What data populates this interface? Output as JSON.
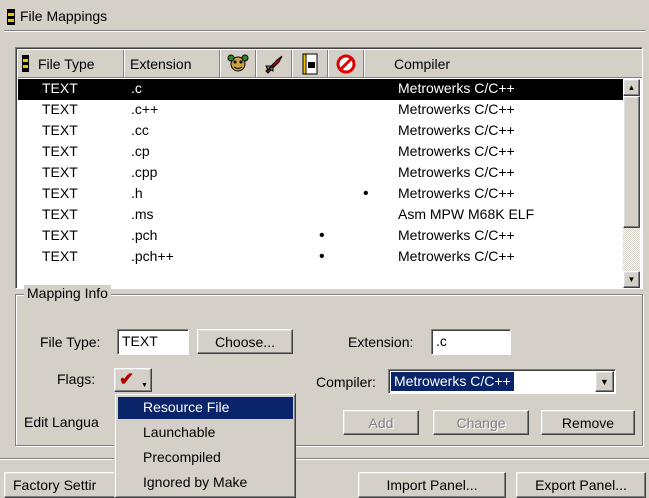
{
  "window": {
    "title": "File Mappings"
  },
  "table": {
    "columns": {
      "file_type": "File Type",
      "extension": "Extension",
      "compiler": "Compiler"
    },
    "header_icons": [
      "panel-icon",
      "resource-icon",
      "launch-icon",
      "precompiled-icon",
      "ignore-icon"
    ],
    "rows": [
      {
        "type": "TEXT",
        "ext": ".c",
        "flag_precompiled": "",
        "flag_ignored": "",
        "compiler": "Metrowerks C/C++"
      },
      {
        "type": "TEXT",
        "ext": ".c++",
        "flag_precompiled": "",
        "flag_ignored": "",
        "compiler": "Metrowerks C/C++"
      },
      {
        "type": "TEXT",
        "ext": ".cc",
        "flag_precompiled": "",
        "flag_ignored": "",
        "compiler": "Metrowerks C/C++"
      },
      {
        "type": "TEXT",
        "ext": ".cp",
        "flag_precompiled": "",
        "flag_ignored": "",
        "compiler": "Metrowerks C/C++"
      },
      {
        "type": "TEXT",
        "ext": ".cpp",
        "flag_precompiled": "",
        "flag_ignored": "",
        "compiler": "Metrowerks C/C++"
      },
      {
        "type": "TEXT",
        "ext": ".h",
        "flag_precompiled": "",
        "flag_ignored": "•",
        "compiler": "Metrowerks C/C++"
      },
      {
        "type": "TEXT",
        "ext": ".ms",
        "flag_precompiled": "",
        "flag_ignored": "",
        "compiler": "Asm MPW M68K ELF"
      },
      {
        "type": "TEXT",
        "ext": ".pch",
        "flag_precompiled": "•",
        "flag_ignored": "",
        "compiler": "Metrowerks C/C++"
      },
      {
        "type": "TEXT",
        "ext": ".pch++",
        "flag_precompiled": "•",
        "flag_ignored": "",
        "compiler": "Metrowerks C/C++"
      }
    ],
    "selected_row": 0
  },
  "mapping_info": {
    "legend": "Mapping Info",
    "file_type_label": "File Type:",
    "file_type_value": "TEXT",
    "choose_button": "Choose...",
    "extension_label": "Extension:",
    "extension_value": ".c",
    "flags_label": "Flags:",
    "compiler_label": "Compiler:",
    "compiler_value": "Metrowerks C/C++",
    "edit_language_label": "Edit Langua",
    "add_button": "Add",
    "change_button": "Change",
    "remove_button": "Remove"
  },
  "flags_menu": {
    "items": [
      "Resource File",
      "Launchable",
      "Precompiled",
      "Ignored by Make"
    ],
    "highlighted": 0
  },
  "footer": {
    "factory_settings_button": "Factory Settir",
    "import_button": "Import Panel...",
    "export_button": "Export Panel..."
  },
  "colors": {
    "selection": "#0a246a",
    "row_selected": "#000000",
    "panel_bg": "#d4d0c8",
    "check_red": "#b00000"
  }
}
